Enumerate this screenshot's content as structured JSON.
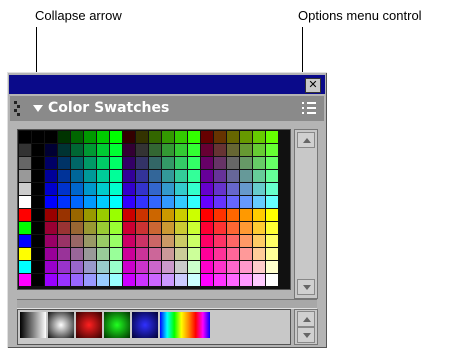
{
  "annotations": {
    "collapse_arrow": "Collapse arrow",
    "options_menu": "Options menu control"
  },
  "panel": {
    "title": "Color Swatches",
    "close_glyph": "✕"
  },
  "colors": {
    "titlebar": "#0a0a8a",
    "header": "#8a8a8a",
    "panel_bg": "#b4b4b4"
  },
  "icons": {
    "grip": "grip-dots-icon",
    "collapse": "triangle-down-icon",
    "options": "options-menu-icon",
    "close": "close-icon"
  }
}
